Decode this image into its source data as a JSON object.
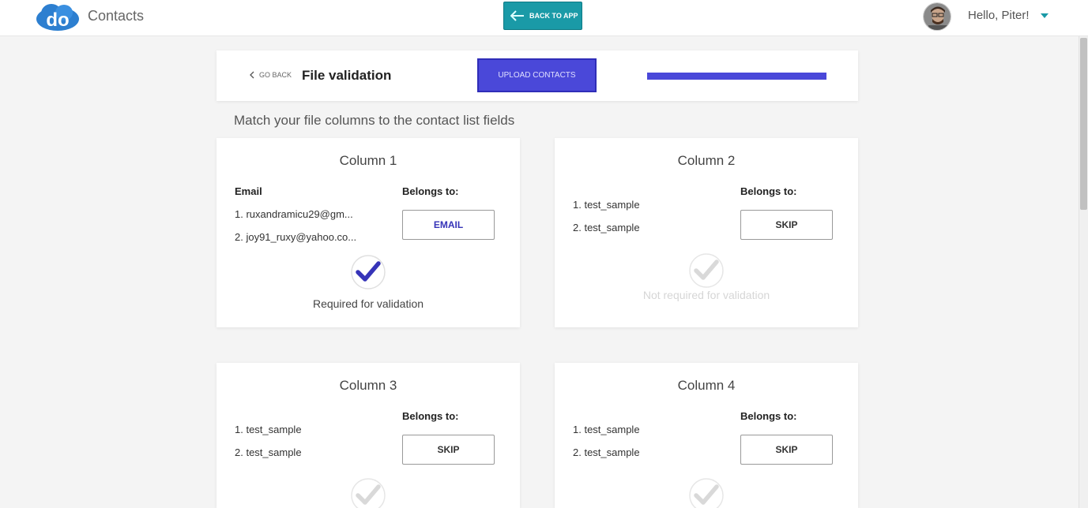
{
  "header": {
    "app_title": "Contacts",
    "back_button": "BACK TO APP",
    "greeting": "Hello, Piter!"
  },
  "top_panel": {
    "go_back": "GO BACK",
    "title": "File validation",
    "upload_button": "UPLOAD CONTACTS",
    "progress": 1.0
  },
  "subtitle": "Match your file columns to the contact list fields",
  "columns": [
    {
      "title": "Column 1",
      "header": "Email",
      "belongs_label": "Belongs to:",
      "samples": [
        "1. ruxandramicu29@gm...",
        "2. joy91_ruxy@yahoo.co..."
      ],
      "mapping": "EMAIL",
      "required_text": "Required for validation"
    },
    {
      "title": "Column 2",
      "header": "",
      "belongs_label": "Belongs to:",
      "samples": [
        "1. test_sample",
        "2. test_sample"
      ],
      "mapping": "SKIP",
      "required_text": "Not required for validation"
    },
    {
      "title": "Column 3",
      "header": "",
      "belongs_label": "Belongs to:",
      "samples": [
        "1. test_sample",
        "2. test_sample"
      ],
      "mapping": "SKIP",
      "required_text": ""
    },
    {
      "title": "Column 4",
      "header": "",
      "belongs_label": "Belongs to:",
      "samples": [
        "1. test_sample",
        "2. test_sample"
      ],
      "mapping": "SKIP",
      "required_text": ""
    }
  ],
  "colors": {
    "accent": "#4a48d9",
    "teal": "#1a9aa7",
    "check_active": "#3634b8",
    "check_inactive": "#d9d9d9"
  }
}
